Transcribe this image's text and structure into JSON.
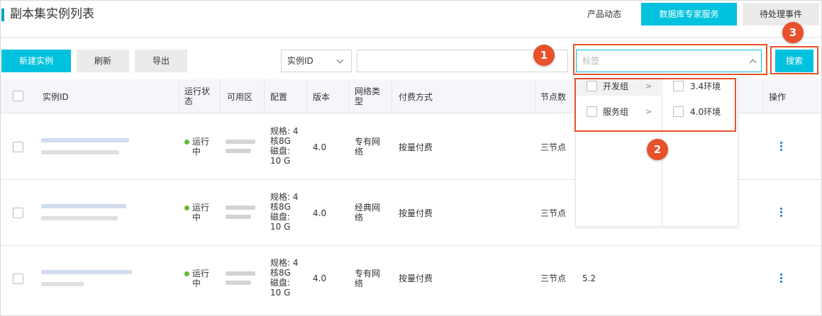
{
  "header": {
    "title": "副本集实例列表",
    "links": [
      "产品动态"
    ],
    "primary_button": "数据库专家服务",
    "secondary_button": "待处理事件"
  },
  "toolbar": {
    "create_label": "新建实例",
    "refresh_label": "刷新",
    "export_label": "导出",
    "search_field_select": "实例ID",
    "search_value": "",
    "tag_placeholder": "标签",
    "search_label": "搜索"
  },
  "table": {
    "columns": [
      "实例ID",
      "运行状态",
      "可用区",
      "配置",
      "版本",
      "网络类型",
      "付费方式",
      "节点数",
      "操作"
    ],
    "rows": [
      {
        "status": "运行中",
        "config": [
          "规格: 4",
          "核8G",
          "磁盘:",
          "10 G"
        ],
        "version": "4.0",
        "network": [
          "专有网",
          "络"
        ],
        "billing": "按量付费",
        "nodes": "三节点",
        "extra": ""
      },
      {
        "status": "运行中",
        "config": [
          "规格: 4",
          "核8G",
          "磁盘:",
          "10 G"
        ],
        "version": "4.0",
        "network": [
          "经典网",
          "络"
        ],
        "billing": "按量付费",
        "nodes": "三节点",
        "extra": ""
      },
      {
        "status": "运行中",
        "config": [
          "规格: 4",
          "核8G",
          "磁盘:",
          "10 G"
        ],
        "version": "4.0",
        "network": [
          "专有网",
          "络"
        ],
        "billing": "按量付费",
        "nodes": "三节点",
        "extra": "5.2"
      }
    ]
  },
  "tag_dropdown": {
    "groups": [
      {
        "label": "开发组",
        "arrow": ">"
      },
      {
        "label": "服务组",
        "arrow": ">"
      }
    ],
    "values": [
      "3.4环境",
      "4.0环境"
    ]
  },
  "callouts": [
    "1",
    "2",
    "3"
  ],
  "colors": {
    "accent": "#00c1de",
    "callout": "#e8512b",
    "status_running": "#5fb83a",
    "link": "#0b74c6"
  },
  "icons": {
    "select_arrow": "chevron-down-icon",
    "tag_arrow": "chevron-up-icon",
    "more": "more-vertical-icon",
    "submenu": "chevron-right-icon"
  }
}
